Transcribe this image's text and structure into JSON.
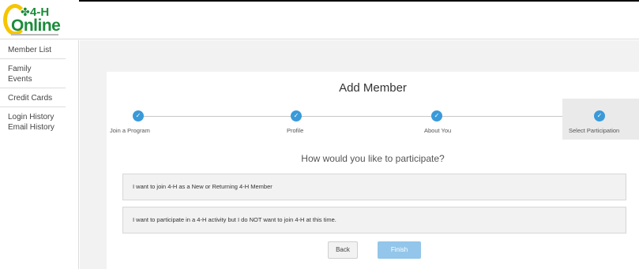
{
  "brand": {
    "line1": "4-H",
    "line2": "Online"
  },
  "sidebar": {
    "groups": [
      {
        "items": [
          "Member List"
        ]
      },
      {
        "items": [
          "Family",
          "Events"
        ]
      },
      {
        "items": [
          "Credit Cards"
        ]
      },
      {
        "items": [
          "Login History",
          "Email History"
        ]
      }
    ]
  },
  "wizard": {
    "title": "Add Member",
    "steps": [
      {
        "label": "Join a Program",
        "completed": true
      },
      {
        "label": "Profile",
        "completed": true
      },
      {
        "label": "About You",
        "completed": true
      },
      {
        "label": "Select Participation",
        "completed": true,
        "active": true
      }
    ],
    "question": "How would you like to participate?",
    "options": [
      "I want to join 4-H as a New or Returning 4-H Member",
      "I want to participate in a 4-H activity but I do NOT want to join 4-H at this time."
    ],
    "back_label": "Back",
    "finish_label": "Finish"
  },
  "colors": {
    "accent": "#3a9ad9",
    "brand_green": "#1a8c3a",
    "brand_yellow": "#f7c500",
    "finish_disabled": "#93c6ea"
  },
  "icons": {
    "step_complete": "check-icon"
  }
}
